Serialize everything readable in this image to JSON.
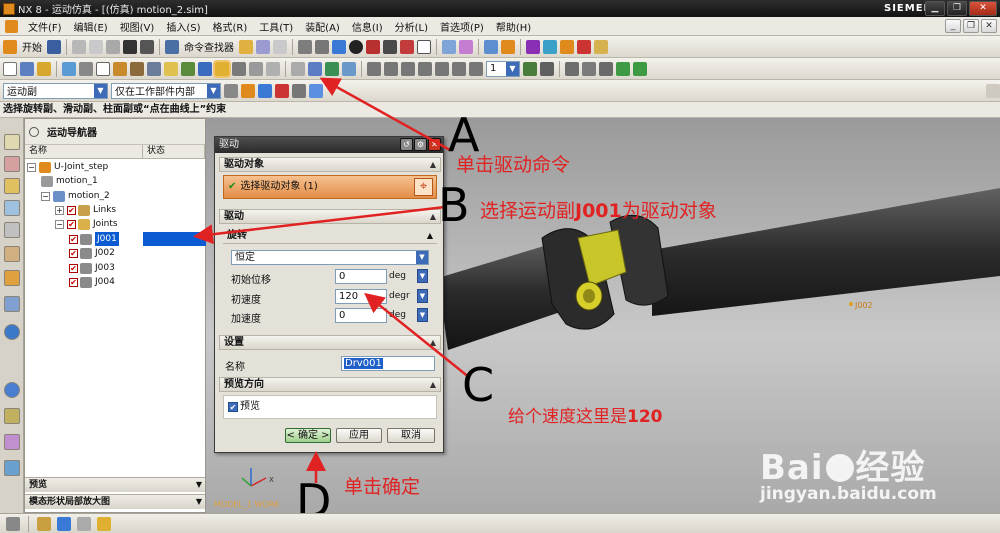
{
  "titlebar": {
    "title": "NX 8 - 运动仿真 - [(仿真) motion_2.sim]",
    "brand": "SIEMENS",
    "min_icon": "minimize-icon",
    "restore_icon": "restore-icon",
    "close_icon": "close-icon"
  },
  "menubar": {
    "items": [
      "文件(F)",
      "编辑(E)",
      "视图(V)",
      "插入(S)",
      "格式(R)",
      "工具(T)",
      "装配(A)",
      "信息(I)",
      "分析(L)",
      "首选项(P)",
      "帮助(H)"
    ]
  },
  "toolbar1": {
    "start_label": "开始",
    "cmd_finder_label": "命令查找器"
  },
  "toolbar3": {
    "filter_value": "运动副",
    "scope_value": "仅在工作部件内部",
    "spin_value": "1"
  },
  "cue": {
    "text": "选择旋转副、滑动副、柱面副或“点在曲线上”约束"
  },
  "navigator": {
    "title": "运动导航器",
    "col_name": "名称",
    "col_status": "状态",
    "root": "U-Joint_step",
    "motion1": "motion_1",
    "motion2": "motion_2",
    "links": "Links",
    "joints": "Joints",
    "joint_items": [
      "J001",
      "J002",
      "J003",
      "J004"
    ],
    "panel_preview": "预览",
    "panel_shape": "模态形状局部放大图"
  },
  "dialog": {
    "title": "驱动",
    "group_drive_object": "驱动对象",
    "select_label": "选择驱动对象 (1)",
    "group_drive": "驱动",
    "sub_rotation": "旋转",
    "type_value": "恒定",
    "init_disp_label": "初始位移",
    "init_disp_value": "0",
    "init_disp_unit": "deg",
    "init_vel_label": "初速度",
    "init_vel_value": "120",
    "init_vel_unit": "degr",
    "accel_label": "加速度",
    "accel_value": "0",
    "accel_unit": "deg",
    "group_settings": "设置",
    "name_label": "名称",
    "name_value": "Drv001",
    "group_preview_dir": "预览方向",
    "preview_label": "预览",
    "ok_label": "< 确定 >",
    "apply_label": "应用",
    "cancel_label": "取消"
  },
  "graphics": {
    "joint_label": "J002",
    "triad_label": "MODEL_1 WORK"
  },
  "annotations": {
    "a_text": "单击驱动命令",
    "b_text_prefix": "选择运动副",
    "b_text_bold": "J001",
    "b_text_suffix": "为驱动对象",
    "c_text_prefix": "给个速度这里是",
    "c_text_bold": "120",
    "d_text": "单击确定",
    "letter_a": "A",
    "letter_b": "B",
    "letter_c": "C",
    "letter_d": "D"
  },
  "watermark": {
    "brand": "Bai",
    "brand_suffix": "经验",
    "url": "jingyan.baidu.com"
  }
}
